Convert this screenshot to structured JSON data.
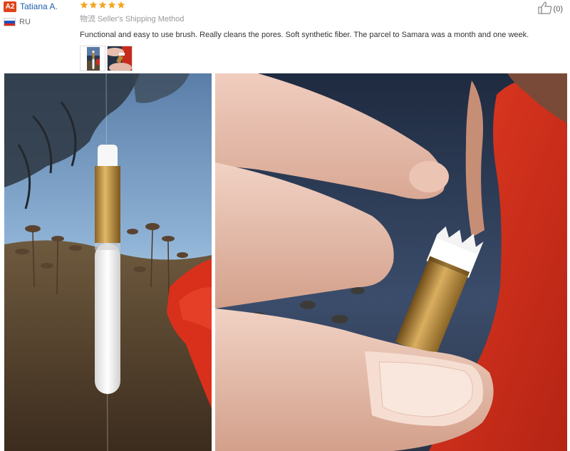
{
  "reviewer": {
    "level_badge": "A2",
    "name": "Tatiana A.",
    "country": "RU"
  },
  "review": {
    "rating": 5,
    "rating_color": "#f5a623",
    "shipping_method": "物流  Seller's Shipping Method",
    "text": "Functional and easy to use brush. Really cleans the pores. Soft synthetic fiber. The parcel to Samara was a month and one week.",
    "helpful_count": "(0)"
  },
  "photos": {
    "thumbnails": [
      "photo-thumbnail-1",
      "photo-thumbnail-2"
    ],
    "large": [
      "brush-on-poster-photo",
      "brush-held-in-fingers-photo"
    ]
  },
  "colors": {
    "name_link": "#1f5ea8",
    "badge": "#e0431b",
    "dress_red": "#d9301c",
    "brush_gold": "#b8893a"
  }
}
